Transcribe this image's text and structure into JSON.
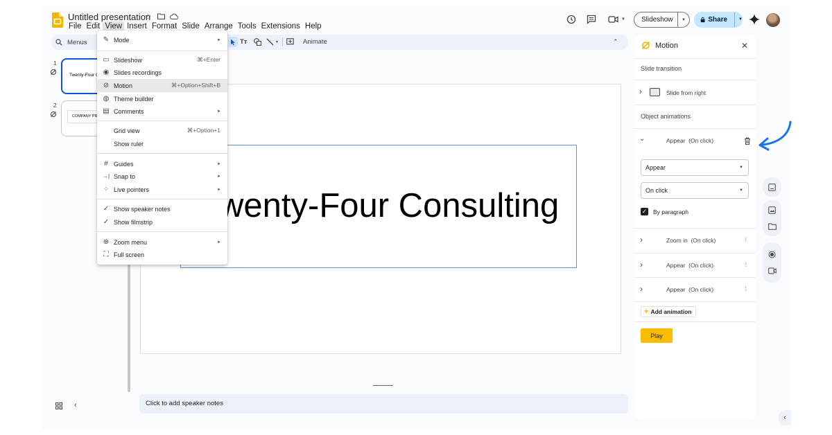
{
  "app": {
    "title": "Untitled presentation",
    "menu": [
      "File",
      "Edit",
      "View",
      "Insert",
      "Format",
      "Slide",
      "Arrange",
      "Tools",
      "Extensions",
      "Help"
    ]
  },
  "header": {
    "slideshow_label": "Slideshow",
    "share_label": "Share"
  },
  "toolbar": {
    "menus_label": "Menus",
    "animate_label": "Animate"
  },
  "filmstrip": {
    "slides": [
      {
        "number": "1",
        "text": "Twenty-Four C"
      },
      {
        "number": "2",
        "text": "COMPANY PR"
      }
    ]
  },
  "slide": {
    "title": "wenty-Four Consulting"
  },
  "notes": {
    "placeholder": "Click to add speaker notes"
  },
  "view_menu": {
    "items": [
      {
        "icon": "pencil-icon",
        "glyph": "✎",
        "label": "Mode",
        "submenu": true
      },
      {
        "icon": "slideshow-icon",
        "glyph": "▭",
        "label": "Slideshow",
        "shortcut": "⌘+Enter"
      },
      {
        "icon": "record-icon",
        "glyph": "◉",
        "label": "Slides recordings"
      },
      {
        "icon": "motion-icon",
        "glyph": "⊘",
        "label": "Motion",
        "shortcut": "⌘+Option+Shift+B",
        "highlighted": true
      },
      {
        "icon": "palette-icon",
        "glyph": "◍",
        "label": "Theme builder"
      },
      {
        "icon": "comment-icon",
        "glyph": "▤",
        "label": "Comments",
        "submenu": true
      },
      {
        "icon": "",
        "glyph": "",
        "label": "Grid view",
        "shortcut": "⌘+Option+1"
      },
      {
        "icon": "",
        "glyph": "",
        "label": "Show ruler"
      },
      {
        "icon": "guides-icon",
        "glyph": "#",
        "label": "Guides",
        "submenu": true
      },
      {
        "icon": "snap-icon",
        "glyph": "→|",
        "label": "Snap to",
        "submenu": true
      },
      {
        "icon": "pointer-icon",
        "glyph": "⁘",
        "label": "Live pointers",
        "submenu": true
      },
      {
        "icon": "check-icon",
        "glyph": "✓",
        "label": "Show speaker notes"
      },
      {
        "icon": "check-icon",
        "glyph": "✓",
        "label": "Show filmstrip"
      },
      {
        "icon": "zoom-icon",
        "glyph": "⊕",
        "label": "Zoom menu",
        "submenu": true
      },
      {
        "icon": "fullscreen-icon",
        "glyph": "⛶",
        "label": "Full screen"
      }
    ]
  },
  "motion_panel": {
    "title": "Motion",
    "slide_transition_heading": "Slide transition",
    "transition_label": "Slide from right",
    "object_animations_heading": "Object animations",
    "expanded_animation": {
      "name": "Appear",
      "trigger": "(On click)"
    },
    "effect_select": "Appear",
    "trigger_select": "On click",
    "by_paragraph_label": "By paragraph",
    "by_paragraph_checked": true,
    "animations": [
      {
        "name": "Zoom in",
        "trigger": "(On click)"
      },
      {
        "name": "Appear",
        "trigger": "(On click)"
      },
      {
        "name": "Appear",
        "trigger": "(On click)"
      }
    ],
    "add_animation_label": "Add animation",
    "play_label": "Play"
  },
  "colors": {
    "accent_blue": "#0b57d0",
    "share_bg": "#c2e7ff",
    "play_button": "#fbbc04",
    "slides_logo": "#f4b400",
    "annotation_arrow": "#1a73e8"
  }
}
